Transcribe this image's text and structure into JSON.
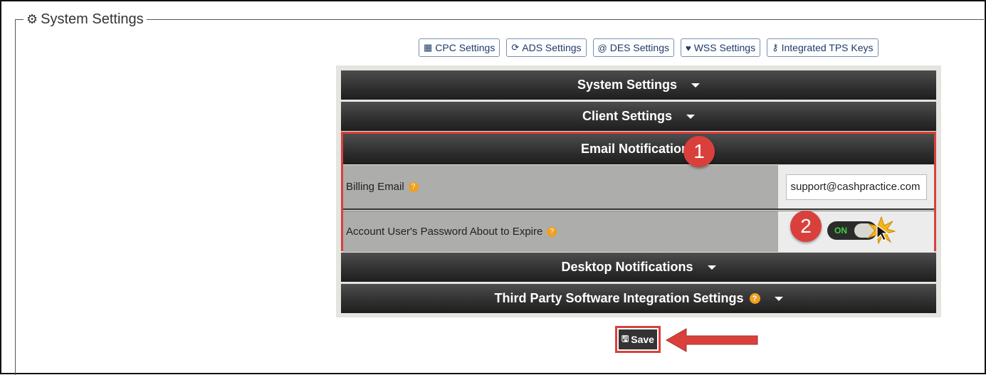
{
  "fieldset": {
    "legend": "System Settings",
    "legend_icon": "gear-icon"
  },
  "tabs": [
    {
      "label": "CPC Settings",
      "icon": "calculator-icon"
    },
    {
      "label": "ADS Settings",
      "icon": "refresh-icon"
    },
    {
      "label": "DES Settings",
      "icon": "at-icon"
    },
    {
      "label": "WSS Settings",
      "icon": "heartbeat-icon"
    },
    {
      "label": "Integrated TPS Keys",
      "icon": "key-icon"
    }
  ],
  "accordion": {
    "system_settings": "System Settings",
    "client_settings": "Client Settings",
    "email_notifications": "Email Notifications",
    "desktop_notifications": "Desktop Notifications",
    "third_party": "Third Party Software Integration Settings"
  },
  "email": {
    "billing_label": "Billing Email",
    "billing_value": "support@cashpractice.com",
    "password_label": "Account User's Password About to Expire",
    "toggle_label": "ON"
  },
  "callouts": {
    "one": "1",
    "two": "2"
  },
  "save_label": "Save",
  "colors": {
    "accent_red": "#d9403c",
    "header_dark": "#2f2f2f",
    "help_orange": "#f0a020",
    "toggle_on_green": "#3ed23e"
  }
}
